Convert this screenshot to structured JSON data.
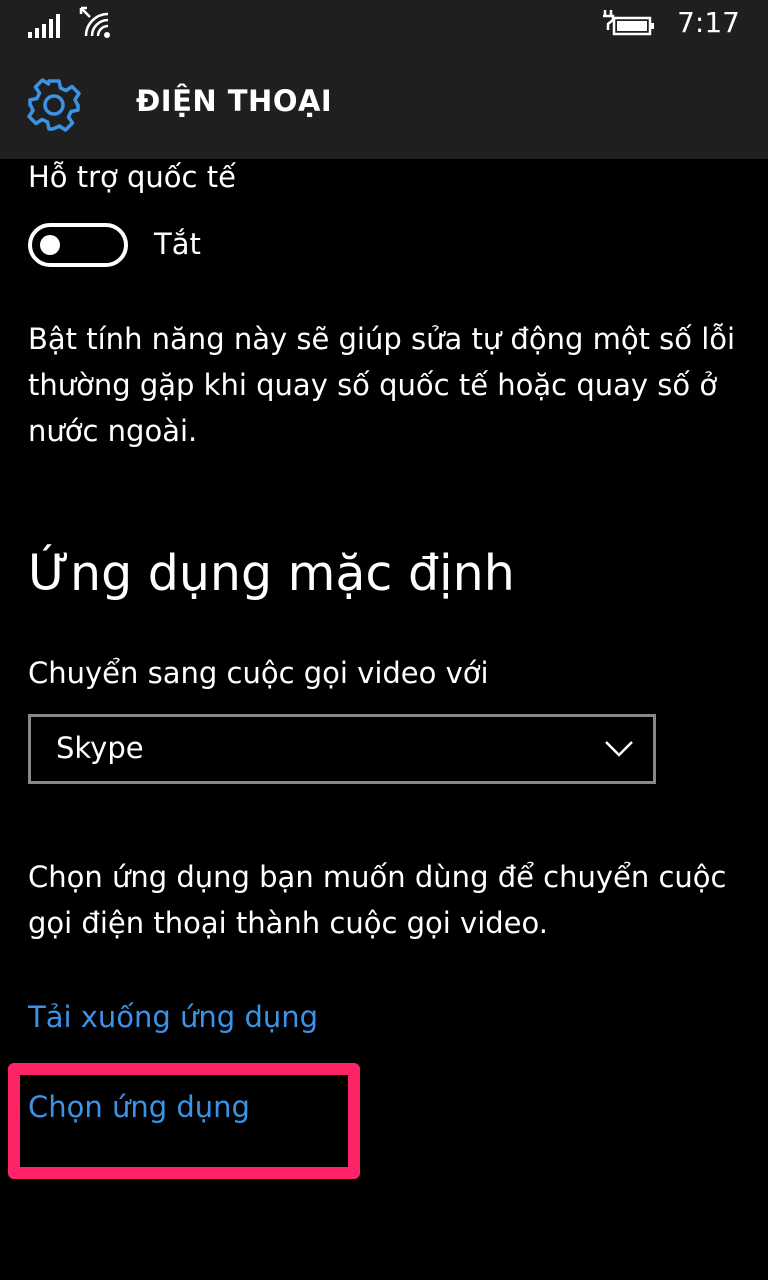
{
  "status_bar": {
    "time": "7:17",
    "icons": [
      "signal-icon",
      "wifi-icon",
      "battery-charging-icon"
    ]
  },
  "header": {
    "icon": "gear-icon",
    "title": "ĐIỆN THOẠI"
  },
  "international": {
    "label": "Hỗ trợ quốc tế",
    "toggle_state": "Tắt",
    "description": "Bật tính năng này sẽ giúp sửa tự động một số lỗi thường gặp khi quay số quốc tế hoặc quay số ở nước ngoài."
  },
  "default_apps": {
    "title": "Ứng dụng mặc định",
    "video_label": "Chuyển sang cuộc gọi video với",
    "selected_app": "Skype",
    "description": "Chọn ứng dụng bạn muốn dùng để chuyển cuộc gọi điện thoại thành cuộc gọi video.",
    "download_link": "Tải xuống ứng dụng",
    "choose_link": "Chọn ứng dụng"
  },
  "colors": {
    "accent": "#3c93e6",
    "highlight": "#ff2468",
    "header_bg": "#1f1f1f"
  }
}
